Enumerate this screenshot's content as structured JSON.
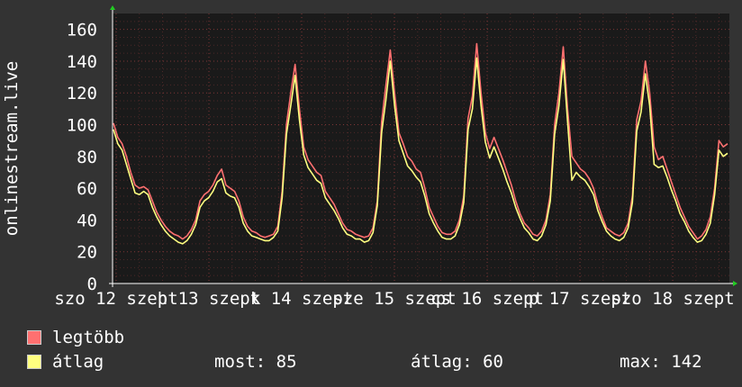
{
  "chart_data": {
    "type": "line",
    "ylabel": "onlinestream.live",
    "ylim": [
      0,
      170
    ],
    "yticks": [
      0,
      20,
      40,
      60,
      80,
      100,
      120,
      140,
      160
    ],
    "x_tick_labels": [
      "szo 12 szept",
      "h 13 szept",
      "k 14 szept",
      "sze 15 szept",
      "cs 16 szept",
      "p 17 szept",
      "szo 18 szept"
    ],
    "colors": {
      "max": "#ff7070",
      "avg": "#ffff80",
      "background": "#1a1a1a",
      "grid": "#8b3a3a",
      "axis": "#ffffff"
    },
    "series": [
      {
        "name": "legtöbb",
        "values": [
          101,
          92,
          88,
          80,
          70,
          62,
          60,
          61,
          59,
          52,
          45,
          40,
          36,
          33,
          31,
          30,
          28,
          30,
          34,
          40,
          52,
          56,
          58,
          62,
          68,
          72,
          62,
          60,
          58,
          52,
          42,
          36,
          33,
          32,
          30,
          29,
          30,
          31,
          36,
          58,
          100,
          120,
          138,
          110,
          86,
          78,
          74,
          70,
          68,
          58,
          54,
          50,
          44,
          38,
          34,
          33,
          31,
          30,
          29,
          30,
          35,
          52,
          102,
          125,
          147,
          120,
          95,
          88,
          80,
          77,
          72,
          70,
          60,
          48,
          42,
          36,
          32,
          31,
          31,
          33,
          40,
          55,
          104,
          118,
          151,
          120,
          95,
          85,
          92,
          85,
          78,
          70,
          62,
          52,
          44,
          38,
          35,
          31,
          30,
          33,
          40,
          56,
          100,
          120,
          149,
          110,
          80,
          76,
          72,
          70,
          66,
          60,
          50,
          42,
          35,
          33,
          31,
          30,
          32,
          38,
          55,
          103,
          115,
          140,
          120,
          86,
          78,
          80,
          72,
          64,
          56,
          48,
          42,
          36,
          32,
          28,
          30,
          34,
          42,
          60,
          90,
          86,
          88
        ]
      },
      {
        "name": "átlag",
        "values": [
          97,
          88,
          84,
          75,
          66,
          57,
          56,
          58,
          56,
          48,
          42,
          37,
          33,
          30,
          28,
          26,
          25,
          27,
          31,
          37,
          48,
          52,
          54,
          58,
          64,
          66,
          57,
          55,
          54,
          48,
          38,
          33,
          30,
          29,
          28,
          27,
          27,
          29,
          33,
          54,
          94,
          112,
          131,
          103,
          81,
          73,
          69,
          65,
          63,
          54,
          50,
          46,
          41,
          35,
          31,
          30,
          28,
          28,
          26,
          27,
          32,
          49,
          95,
          116,
          140,
          112,
          90,
          82,
          74,
          71,
          67,
          64,
          55,
          44,
          38,
          33,
          29,
          28,
          28,
          30,
          37,
          51,
          97,
          110,
          142,
          112,
          89,
          79,
          86,
          79,
          72,
          64,
          57,
          48,
          41,
          35,
          32,
          28,
          27,
          30,
          37,
          52,
          94,
          112,
          141,
          102,
          65,
          70,
          67,
          65,
          61,
          56,
          46,
          39,
          33,
          30,
          28,
          27,
          29,
          35,
          51,
          96,
          108,
          132,
          112,
          75,
          73,
          74,
          67,
          59,
          52,
          44,
          39,
          33,
          29,
          26,
          27,
          31,
          38,
          56,
          84,
          80,
          82
        ]
      }
    ]
  },
  "legend": {
    "max_label": "legtöbb",
    "avg_label": "átlag",
    "current_text": "most: 85",
    "average_text": "átlag: 60",
    "max_text": "max: 142"
  }
}
